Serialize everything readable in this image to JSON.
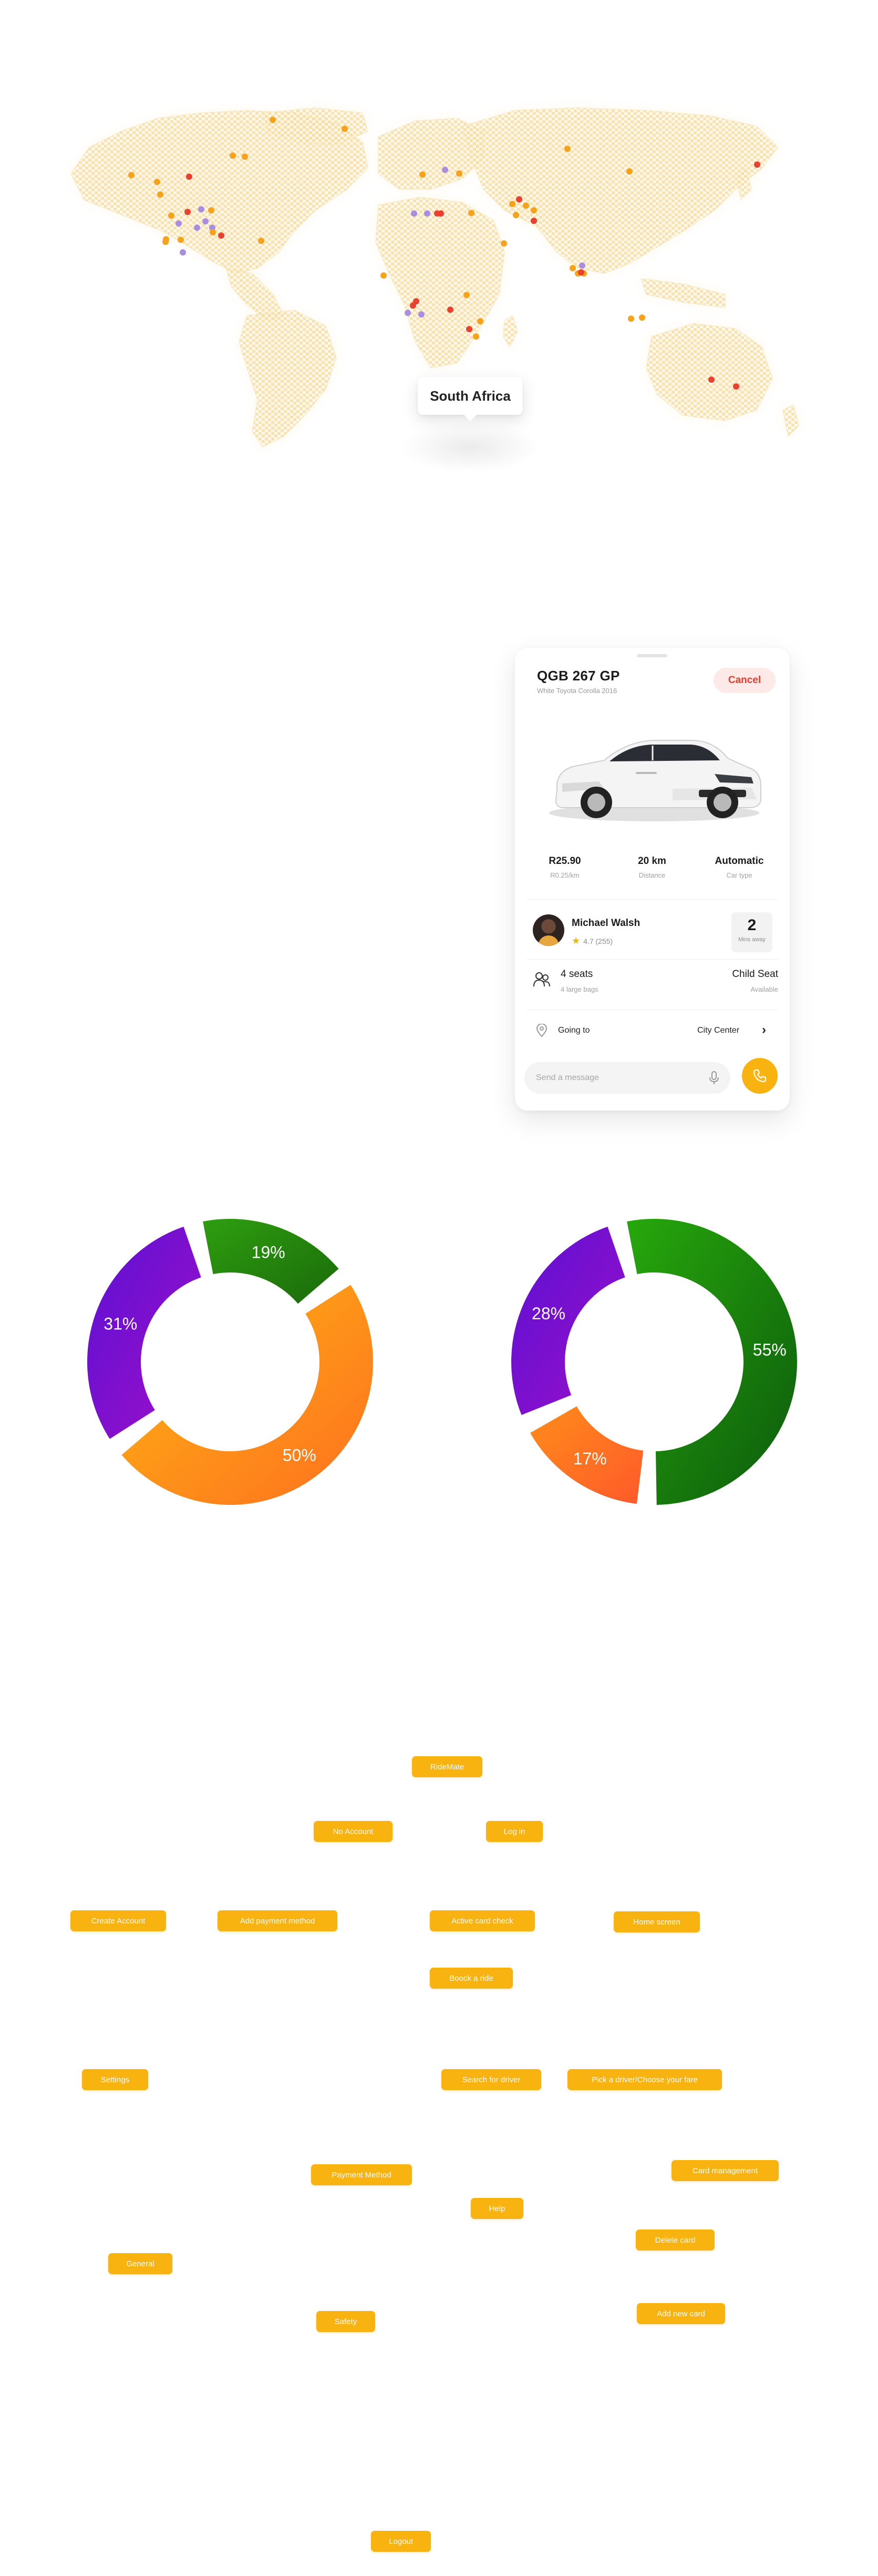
{
  "map": {
    "tooltip_label": "South Africa",
    "land_color": "#f6e2b0",
    "marker_colors": {
      "orange": "#f7a21b",
      "red": "#e8412f",
      "purple": "#a98ee0"
    },
    "markers": [
      {
        "c": "orange"
      },
      {
        "c": "orange"
      },
      {
        "c": "red"
      },
      {
        "c": "orange"
      },
      {
        "c": "orange"
      },
      {
        "c": "orange"
      },
      {
        "c": "purple"
      },
      {
        "c": "purple"
      },
      {
        "c": "orange"
      },
      {
        "c": "red"
      },
      {
        "c": "purple"
      },
      {
        "c": "orange"
      },
      {
        "c": "purple"
      },
      {
        "c": "orange"
      },
      {
        "c": "orange"
      },
      {
        "c": "purple"
      },
      {
        "c": "purple"
      },
      {
        "c": "orange"
      },
      {
        "c": "orange"
      },
      {
        "c": "red"
      },
      {
        "c": "orange"
      },
      {
        "c": "orange"
      },
      {
        "c": "orange"
      },
      {
        "c": "purple"
      },
      {
        "c": "purple"
      },
      {
        "c": "purple"
      },
      {
        "c": "red"
      },
      {
        "c": "red"
      },
      {
        "c": "orange"
      },
      {
        "c": "orange"
      },
      {
        "c": "orange"
      },
      {
        "c": "orange"
      },
      {
        "c": "orange"
      },
      {
        "c": "red"
      },
      {
        "c": "orange"
      },
      {
        "c": "orange"
      },
      {
        "c": "orange"
      },
      {
        "c": "purple"
      },
      {
        "c": "orange"
      },
      {
        "c": "red"
      },
      {
        "c": "orange"
      },
      {
        "c": "red"
      },
      {
        "c": "orange"
      },
      {
        "c": "orange"
      },
      {
        "c": "red"
      },
      {
        "c": "orange"
      },
      {
        "c": "orange"
      },
      {
        "c": "orange"
      },
      {
        "c": "red"
      },
      {
        "c": "red"
      },
      {
        "c": "orange"
      },
      {
        "c": "orange"
      },
      {
        "c": "red"
      },
      {
        "c": "red"
      },
      {
        "c": "orange"
      },
      {
        "c": "purple"
      },
      {
        "c": "purple"
      },
      {
        "c": "orange"
      },
      {
        "c": "red"
      },
      {
        "c": "red"
      }
    ]
  },
  "ride": {
    "plate": "QGB 267 GP",
    "car_model": "White Toyota Corolla 2016",
    "cancel_label": "Cancel",
    "stats": [
      {
        "value": "R25.90",
        "label": "R0.25/km"
      },
      {
        "value": "20 km",
        "label": "Distance"
      },
      {
        "value": "Automatic",
        "label": "Car type"
      }
    ],
    "driver": {
      "name": "Michael Walsh",
      "rating": "4.7 (255)",
      "eta_value": "2",
      "eta_unit": "Mins away"
    },
    "seats": "4 seats",
    "bags": "4 large bags",
    "child_seat": "Child Seat",
    "child_seat_status": "Available",
    "going_label": "Going to",
    "destination": "City Center",
    "message_placeholder": "Send a message",
    "accent_color": "#f9b310"
  },
  "chart_data": [
    {
      "type": "pie",
      "variant": "donut",
      "categories": [
        "19%",
        "50%",
        "31%"
      ],
      "values": [
        19,
        50,
        31
      ],
      "labels": [
        "19%",
        "50%",
        "31%"
      ],
      "colors": [
        [
          "#2e9e10",
          "#1a6a0a"
        ],
        [
          "#fdb713",
          "#ff6f1f"
        ],
        [
          "#5b10d4",
          "#a010c8"
        ]
      ]
    },
    {
      "type": "pie",
      "variant": "donut",
      "categories": [
        "55%",
        "17%",
        "28%"
      ],
      "values": [
        55,
        17,
        28
      ],
      "labels": [
        "55%",
        "17%",
        "28%"
      ],
      "colors": [
        [
          "#27a80c",
          "#0c5a0c"
        ],
        [
          "#ff8c1a",
          "#ff5a2a"
        ],
        [
          "#5b10d4",
          "#9b10c8"
        ]
      ]
    }
  ],
  "sitemap": {
    "nodes": [
      {
        "id": "ridemate",
        "label": "RideMate"
      },
      {
        "id": "no-account",
        "label": "No Account"
      },
      {
        "id": "log-in",
        "label": "Log in"
      },
      {
        "id": "create-account",
        "label": "Create Account"
      },
      {
        "id": "add-payment",
        "label": "Add payment method"
      },
      {
        "id": "active-card",
        "label": "Active card check"
      },
      {
        "id": "home-screen",
        "label": "Home screen"
      },
      {
        "id": "book-ride",
        "label": "Boock a ride"
      },
      {
        "id": "settings",
        "label": "Settings"
      },
      {
        "id": "search-driver",
        "label": "Search for driver"
      },
      {
        "id": "pick-driver",
        "label": "Pick a driver/Choose your fare"
      },
      {
        "id": "card-management",
        "label": "Card management"
      },
      {
        "id": "payment-method",
        "label": "Payment Method"
      },
      {
        "id": "help",
        "label": "Help"
      },
      {
        "id": "delete-card",
        "label": "Delete card"
      },
      {
        "id": "general",
        "label": "General"
      },
      {
        "id": "safety",
        "label": "Safety"
      },
      {
        "id": "add-new-card",
        "label": "Add new card"
      },
      {
        "id": "logout",
        "label": "Logout"
      }
    ]
  }
}
